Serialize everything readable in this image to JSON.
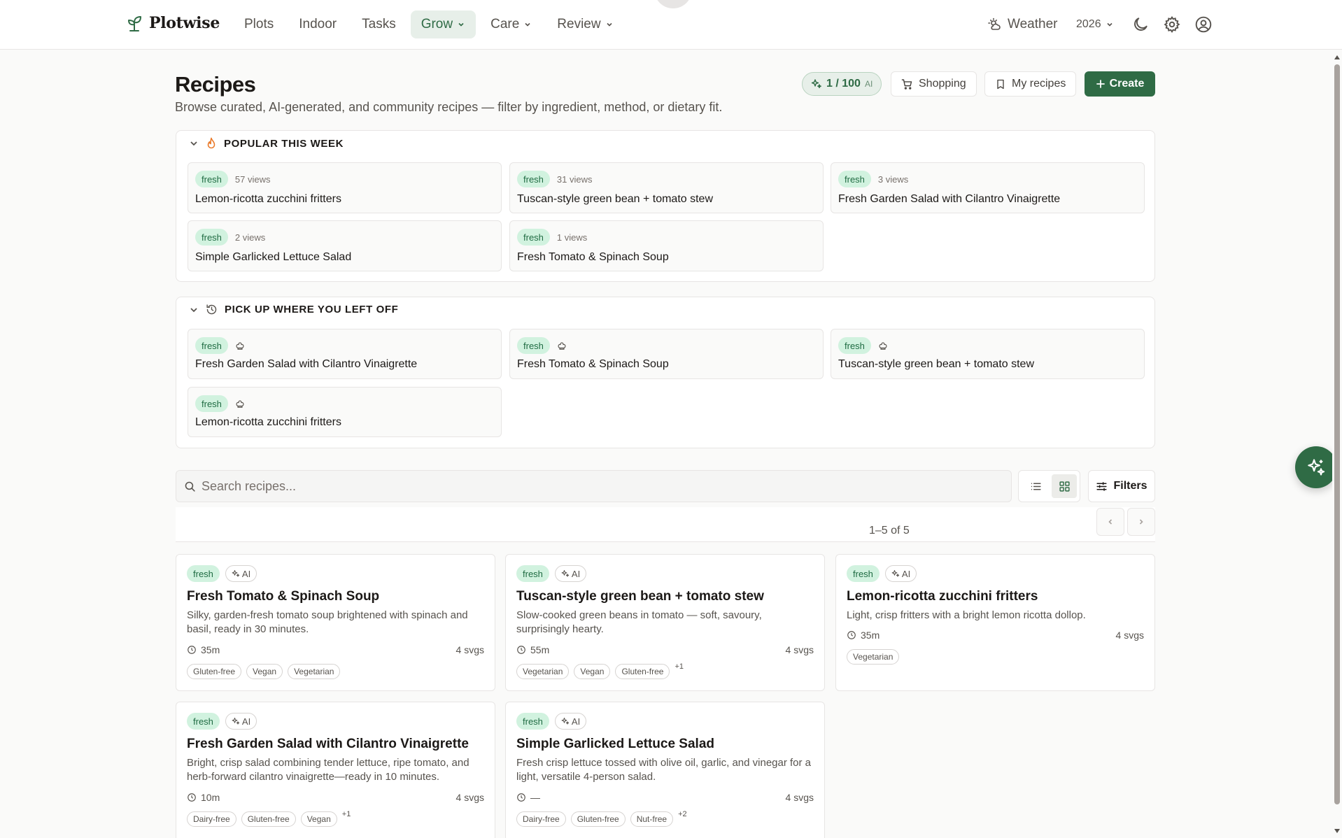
{
  "app": {
    "name": "Plotwise"
  },
  "nav": {
    "links": [
      {
        "label": "Plots"
      },
      {
        "label": "Indoor"
      },
      {
        "label": "Tasks"
      },
      {
        "label": "Grow"
      },
      {
        "label": "Care"
      },
      {
        "label": "Review"
      }
    ],
    "active": "Grow",
    "weather_label": "Weather",
    "year": "2026"
  },
  "header": {
    "title": "Recipes",
    "subtitle": "Browse curated, AI-generated, and community recipes — filter by ingredient, method, or dietary fit.",
    "ai_quota": "1 / 100",
    "ai_quota_suffix": "AI",
    "shopping_label": "Shopping",
    "my_recipes_label": "My recipes",
    "create_label": "Create"
  },
  "popular": {
    "heading": "POPULAR THIS WEEK",
    "items": [
      {
        "badge": "fresh",
        "views": "57 views",
        "title": "Lemon-ricotta zucchini fritters"
      },
      {
        "badge": "fresh",
        "views": "31 views",
        "title": "Tuscan-style green bean + tomato stew"
      },
      {
        "badge": "fresh",
        "views": "3 views",
        "title": "Fresh Garden Salad with Cilantro Vinaigrette"
      },
      {
        "badge": "fresh",
        "views": "2 views",
        "title": "Simple Garlicked Lettuce Salad"
      },
      {
        "badge": "fresh",
        "views": "1 views",
        "title": "Fresh Tomato & Spinach Soup"
      }
    ]
  },
  "recent": {
    "heading": "PICK UP WHERE YOU LEFT OFF",
    "items": [
      {
        "badge": "fresh",
        "icon": "chef-hat-icon",
        "title": "Fresh Garden Salad with Cilantro Vinaigrette"
      },
      {
        "badge": "fresh",
        "icon": "chef-hat-icon",
        "title": "Fresh Tomato & Spinach Soup"
      },
      {
        "badge": "fresh",
        "icon": "chef-hat-icon",
        "title": "Tuscan-style green bean + tomato stew"
      },
      {
        "badge": "fresh",
        "icon": "chef-hat-icon",
        "title": "Lemon-ricotta zucchini fritters"
      }
    ]
  },
  "search": {
    "placeholder": "Search recipes...",
    "value": ""
  },
  "filters_label": "Filters",
  "view_mode": "grid",
  "pagination": {
    "summary": "1–5 of 5"
  },
  "recipes": [
    {
      "badge": "fresh",
      "ai": "AI",
      "title": "Fresh Tomato & Spinach Soup",
      "desc": "Silky, garden-fresh tomato soup brightened with spinach and basil, ready in 30 minutes.",
      "time": "35m",
      "svgs": "4 svgs",
      "tags": [
        "Gluten-free",
        "Vegan",
        "Vegetarian"
      ],
      "more": ""
    },
    {
      "badge": "fresh",
      "ai": "AI",
      "title": "Tuscan-style green bean + tomato stew",
      "desc": "Slow-cooked green beans in tomato — soft, savoury, surprisingly hearty.",
      "time": "55m",
      "svgs": "4 svgs",
      "tags": [
        "Vegetarian",
        "Vegan",
        "Gluten-free"
      ],
      "more": "+1"
    },
    {
      "badge": "fresh",
      "ai": "AI",
      "title": "Lemon-ricotta zucchini fritters",
      "desc": "Light, crisp fritters with a bright lemon ricotta dollop.",
      "time": "35m",
      "svgs": "4 svgs",
      "tags": [
        "Vegetarian"
      ],
      "more": ""
    },
    {
      "badge": "fresh",
      "ai": "AI",
      "title": "Fresh Garden Salad with Cilantro Vinaigrette",
      "desc": "Bright, crisp salad combining tender lettuce, ripe tomato, and herb-forward cilantro vinaigrette—ready in 10 minutes.",
      "time": "10m",
      "svgs": "4 svgs",
      "tags": [
        "Dairy-free",
        "Gluten-free",
        "Vegan"
      ],
      "more": "+1"
    },
    {
      "badge": "fresh",
      "ai": "AI",
      "title": "Simple Garlicked Lettuce Salad",
      "desc": "Fresh crisp lettuce tossed with olive oil, garlic, and vinegar for a light, versatile 4-person salad.",
      "time": "—",
      "svgs": "4 svgs",
      "tags": [
        "Dairy-free",
        "Gluten-free",
        "Nut-free"
      ],
      "more": "+2"
    }
  ],
  "colors": {
    "brand": "#2f6b45",
    "fresh_bg": "#d1f2df",
    "fresh_fg": "#1f6b42",
    "accent_flame": "#ea7b2c"
  }
}
